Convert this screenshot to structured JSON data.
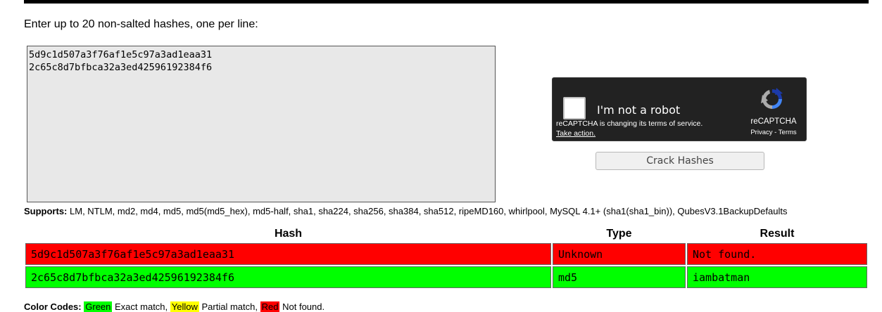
{
  "intro": "Enter up to 20 non-salted hashes, one per line:",
  "textarea": {
    "value": "5d9c1d507a3f76af1e5c97a3ad1eaa31\n2c65c8d7bfbca32a3ed42596192384f6"
  },
  "recaptcha": {
    "label": "I'm not a robot",
    "notice": "reCAPTCHA is changing its terms of service.",
    "action": "Take action.",
    "brand": "reCAPTCHA",
    "privacy": "Privacy",
    "separator": " - ",
    "terms": "Terms"
  },
  "crack_button": "Crack Hashes",
  "supports": {
    "label": "Supports:",
    "list": "LM, NTLM, md2, md4, md5, md5(md5_hex), md5-half, sha1, sha224, sha256, sha384, sha512, ripeMD160, whirlpool, MySQL 4.1+ (sha1(sha1_bin)), QubesV3.1BackupDefaults"
  },
  "table": {
    "headers": [
      "Hash",
      "Type",
      "Result"
    ],
    "rows": [
      {
        "hash": "5d9c1d507a3f76af1e5c97a3ad1eaa31",
        "type": "Unknown",
        "result": "Not found.",
        "status": "red"
      },
      {
        "hash": "2c65c8d7bfbca32a3ed42596192384f6",
        "type": "md5",
        "result": "iambatman",
        "status": "green"
      }
    ]
  },
  "legend": {
    "label": "Color Codes:",
    "green": "Green",
    "green_desc": "Exact match,",
    "yellow": "Yellow",
    "yellow_desc": "Partial match,",
    "red": "Red",
    "red_desc": "Not found."
  },
  "colors": {
    "found": "#00ff00",
    "not_found": "#ff0000",
    "partial": "#ffff00",
    "textarea_bg": "#e8e8e8",
    "recaptcha_bg": "#222222"
  }
}
